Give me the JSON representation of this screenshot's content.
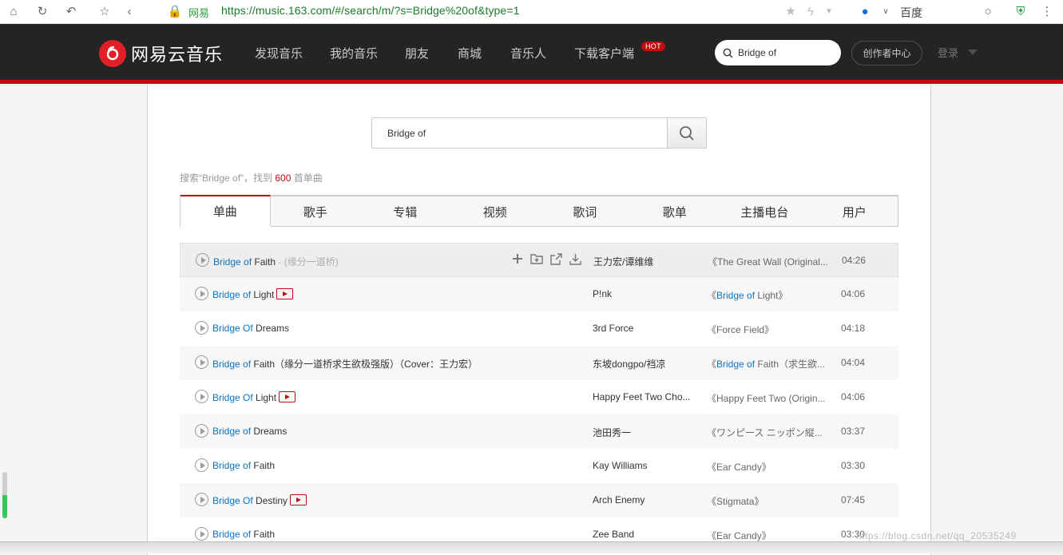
{
  "browser": {
    "site_name": "网易",
    "url": "https://music.163.com/#/search/m/?s=Bridge%20of&type=1",
    "search_engine": "百度"
  },
  "nav": {
    "logo_text": "网易云音乐",
    "items": [
      "发现音乐",
      "我的音乐",
      "朋友",
      "商城",
      "音乐人",
      "下载客户端"
    ],
    "hot_badge": "HOT",
    "search_value": "Bridge of",
    "creator_label": "创作者中心",
    "login_label": "登录"
  },
  "search": {
    "query": "Bridge of",
    "summary_prefix": "搜索“Bridge of”，找到 ",
    "count": "600",
    "summary_suffix": " 首单曲"
  },
  "tabs": [
    "单曲",
    "歌手",
    "专辑",
    "视频",
    "歌词",
    "歌单",
    "主播电台",
    "用户"
  ],
  "active_tab": 0,
  "songs": [
    {
      "kw": "Bridge of",
      "rest": " Faith",
      "sub": " - (缘分一道桥)",
      "mv": false,
      "artist": "王力宏/谭维维",
      "album_pre": "《",
      "album_kw": "",
      "album_rest": "The Great Wall (Original...",
      "album_post": "",
      "duration": "04:26"
    },
    {
      "kw": "Bridge of",
      "rest": " Light",
      "sub": "",
      "mv": true,
      "artist": "P!nk",
      "album_pre": "《",
      "album_kw": "Bridge of",
      "album_rest": " Light",
      "album_post": "》",
      "duration": "04:06"
    },
    {
      "kw": "Bridge Of",
      "rest": " Dreams",
      "sub": "",
      "mv": false,
      "artist": "3rd Force",
      "album_pre": "《",
      "album_kw": "",
      "album_rest": "Force Field",
      "album_post": "》",
      "duration": "04:18"
    },
    {
      "kw": "Bridge of",
      "rest": " Faith（缘分一道桥求生欲极强版）（Cover：王力宏）",
      "sub": "",
      "mv": false,
      "artist": "东坡dongpo/裆凉",
      "album_pre": "《",
      "album_kw": "Bridge of",
      "album_rest": " Faith（求生欲...",
      "album_post": "",
      "duration": "04:04"
    },
    {
      "kw": "Bridge Of",
      "rest": " Light",
      "sub": "",
      "mv": true,
      "artist": "Happy Feet Two Cho...",
      "album_pre": "《",
      "album_kw": "",
      "album_rest": "Happy Feet Two (Origin...",
      "album_post": "",
      "duration": "04:06"
    },
    {
      "kw": "Bridge of",
      "rest": " Dreams",
      "sub": "",
      "mv": false,
      "artist": "池田秀一",
      "album_pre": "《",
      "album_kw": "",
      "album_rest": "ワンピース ニッポン縦...",
      "album_post": "",
      "duration": "03:37"
    },
    {
      "kw": "Bridge of",
      "rest": " Faith",
      "sub": "",
      "mv": false,
      "artist": "Kay Williams",
      "album_pre": "《",
      "album_kw": "",
      "album_rest": "Ear Candy",
      "album_post": "》",
      "duration": "03:30"
    },
    {
      "kw": "Bridge Of",
      "rest": " Destiny",
      "sub": "",
      "mv": true,
      "artist": "Arch Enemy",
      "album_pre": "《",
      "album_kw": "",
      "album_rest": "Stigmata",
      "album_post": "》",
      "duration": "07:45"
    },
    {
      "kw": "Bridge of",
      "rest": " Faith",
      "sub": "",
      "mv": false,
      "artist": "Zee Band",
      "album_pre": "《",
      "album_kw": "",
      "album_rest": "Ear Candy",
      "album_post": "》",
      "duration": "03:30"
    }
  ],
  "watermark": "https://blog.csdn.net/qq_20535249",
  "side_progress": 0.5,
  "colors": {
    "brand_red": "#c20c0c",
    "link_blue": "#0c73c2",
    "nav_bg": "#242424"
  }
}
